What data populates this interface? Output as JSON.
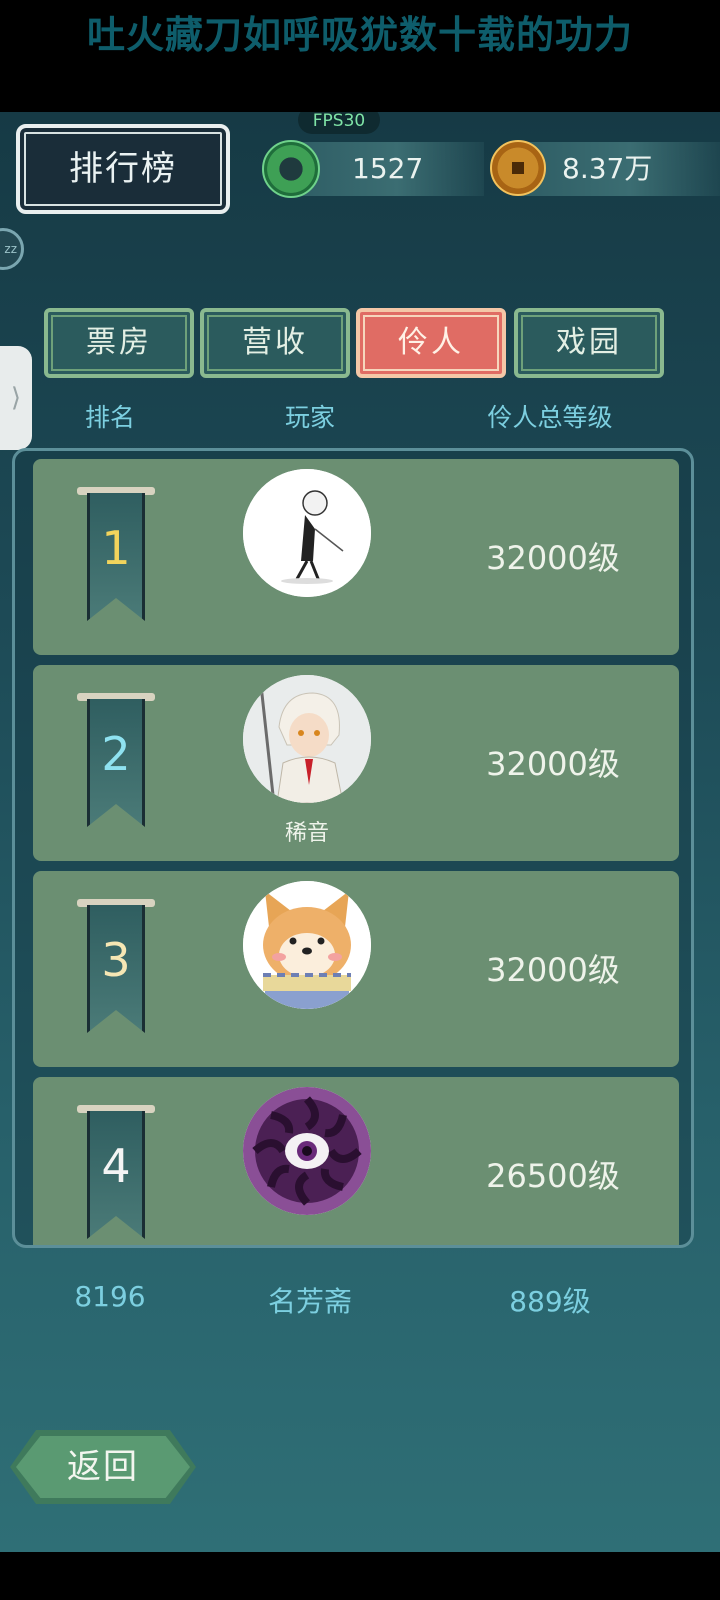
{
  "banner": {
    "title": "吐火藏刀如呼吸犹数十载的功力"
  },
  "status": {
    "fps": "FPS30"
  },
  "header": {
    "title": "排行榜",
    "currencies": [
      {
        "icon": "jade-icon",
        "value": "1527"
      },
      {
        "icon": "coin-icon",
        "value": "8.37万"
      }
    ]
  },
  "tabs": [
    {
      "label": "票房",
      "active": false
    },
    {
      "label": "营收",
      "active": false
    },
    {
      "label": "伶人",
      "active": true
    },
    {
      "label": "戏园",
      "active": false
    }
  ],
  "columns": {
    "rank": "排名",
    "player": "玩家",
    "level": "伶人总等级"
  },
  "rows": [
    {
      "rank": "1",
      "name": "",
      "level": "32000级",
      "rank_color": "#f2d45c",
      "avatar": "sketch-avatar"
    },
    {
      "rank": "2",
      "name": "稀音",
      "level": "32000级",
      "rank_color": "#8fe2f0",
      "avatar": "anime-avatar"
    },
    {
      "rank": "3",
      "name": "",
      "level": "32000级",
      "rank_color": "#f6e7b4",
      "avatar": "shiba-avatar"
    },
    {
      "rank": "4",
      "name": "",
      "level": "26500级",
      "rank_color": "#f4f4f4",
      "avatar": "eye-avatar"
    }
  ],
  "my_rank": {
    "rank": "8196",
    "name": "名芳斋",
    "level": "889级"
  },
  "footer": {
    "back_label": "返回"
  }
}
